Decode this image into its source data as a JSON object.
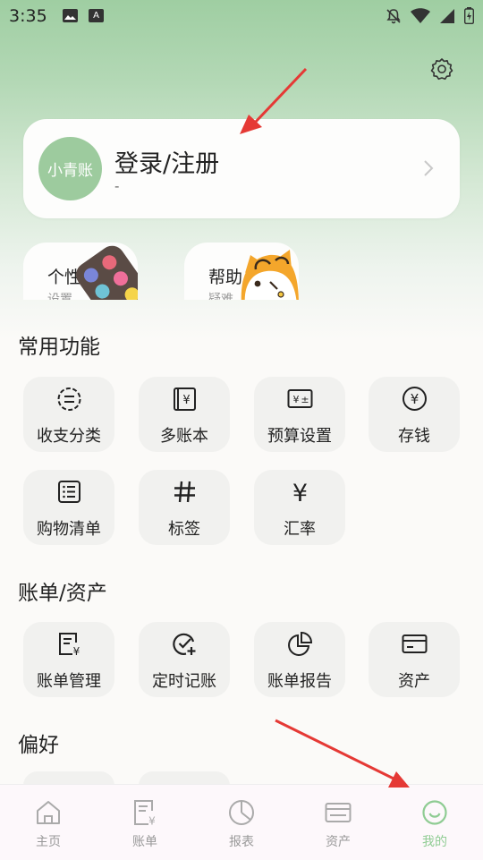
{
  "status": {
    "time": "3:35",
    "a_badge": "A"
  },
  "profile": {
    "logo_text": "小青账",
    "login_label": "登录/注册",
    "login_sub": "-"
  },
  "quick_cards": [
    {
      "title": "个性化",
      "sub": "设置"
    },
    {
      "title": "帮助",
      "sub": "疑难"
    }
  ],
  "sections": {
    "common": "常用功能",
    "bills": "账单/资产",
    "prefs": "偏好"
  },
  "common_funcs": [
    {
      "label": "收支分类",
      "icon": "category-icon"
    },
    {
      "label": "多账本",
      "icon": "multi-book-icon"
    },
    {
      "label": "预算设置",
      "icon": "budget-icon"
    },
    {
      "label": "存钱",
      "icon": "save-money-icon"
    },
    {
      "label": "购物清单",
      "icon": "shopping-list-icon"
    },
    {
      "label": "标签",
      "icon": "tag-icon"
    },
    {
      "label": "汇率",
      "icon": "exchange-rate-icon"
    }
  ],
  "bill_funcs": [
    {
      "label": "账单管理",
      "icon": "bill-manage-icon"
    },
    {
      "label": "定时记账",
      "icon": "scheduled-icon"
    },
    {
      "label": "账单报告",
      "icon": "report-icon"
    },
    {
      "label": "资产",
      "icon": "asset-card-icon"
    }
  ],
  "nav": [
    {
      "label": "主页",
      "icon": "home-icon"
    },
    {
      "label": "账单",
      "icon": "bill-icon"
    },
    {
      "label": "报表",
      "icon": "chart-icon"
    },
    {
      "label": "资产",
      "icon": "wallet-icon"
    },
    {
      "label": "我的",
      "icon": "smile-icon",
      "active": true
    }
  ],
  "colors": {
    "accent": "#8fcc93",
    "arrow": "#e53935"
  }
}
